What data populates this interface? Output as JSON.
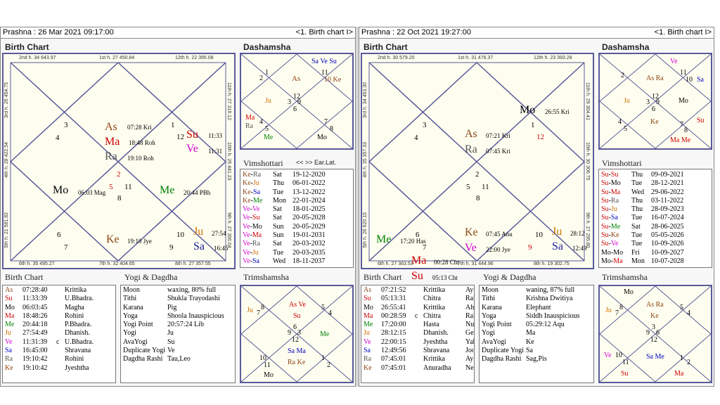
{
  "left": {
    "title": "Prashna :  26 Mar 2021  09:17:00",
    "nav": "<1. Birth chart I>",
    "birth_chart_label": "Birth Chart",
    "dashamsha_label": "Dashamsha",
    "vimshottari_label": "Vimshottari",
    "vim_nav": "<< >> Ear.Lat.",
    "trimshamsha_label": "Trimshamsha",
    "yogi_label": "Yogi & Dagdha",
    "edges": {
      "top1": "2nd h.  34  643.97",
      "top2": "1st h.  27  450.84",
      "top3": "12th h.  22  395.08",
      "bot1": "6th h.  35  495.27",
      "bot2": "7th h.  32  404.65",
      "bot3": "8th h.  27  357.55",
      "l1": "3rd h.  26  454.75",
      "l2": "4th h.  28  422.54",
      "l3": "5th h.  21  581.82",
      "r1": "11th h.  27  316.12",
      "r2": "10th h.  26  441.23",
      "r3": "9th h.  27  356.04"
    },
    "chart_texts": [
      "3",
      "4",
      "As",
      "07:28 Kri",
      "Ma",
      "18:48 Roh",
      "Ra",
      "19:10 Roh",
      "2",
      "5",
      "1",
      "12",
      "Su",
      "11:33",
      "Ve",
      "11:31",
      "Mo",
      "06:03 Mag",
      "11",
      "8",
      "Me",
      "20:44 PBh",
      "6",
      "7",
      "Ke",
      "19:10 Jye",
      "10",
      "9",
      "Ju",
      "27:54",
      "Sa",
      "16:45"
    ],
    "d10": [
      "2",
      "1",
      "As",
      "11",
      "10 Ke",
      "Ju",
      "12",
      "3",
      "9",
      "6",
      "Ma",
      "Ra",
      "4",
      "5",
      "7",
      "8",
      "Me",
      "Mo",
      "Sa Ve Su"
    ],
    "vimshottari": [
      [
        "Ke-Ra",
        "Sat",
        "19-12-2020"
      ],
      [
        "Ke-Ju",
        "Thu",
        "06-01-2022"
      ],
      [
        "Ke-Sa",
        "Tue",
        "13-12-2022"
      ],
      [
        "Ke-Me",
        "Mon",
        "22-01-2024"
      ],
      [
        "Ve-Ve",
        "Sat",
        "18-01-2025"
      ],
      [
        "Ve-Su",
        "Sat",
        "20-05-2028"
      ],
      [
        "Ve-Mo",
        "Sun",
        "20-05-2029"
      ],
      [
        "Ve-Ma",
        "Sun",
        "19-01-2031"
      ],
      [
        "Ve-Ra",
        "Sat",
        "20-03-2032"
      ],
      [
        "Ve-Ju",
        "Tue",
        "20-03-2035"
      ],
      [
        "Ve-Sa",
        "Wed",
        "18-11-2037"
      ]
    ],
    "planets": [
      [
        "As",
        "07:28:40",
        "",
        "Krittika"
      ],
      [
        "Su",
        "11:33:39",
        "",
        "U.Bhadra."
      ],
      [
        "Mo",
        "06:03:45",
        "",
        "Magha"
      ],
      [
        "Ma",
        "18:48:26",
        "",
        "Rohini"
      ],
      [
        "Me",
        "20:44:18",
        "",
        "P.Bhadra."
      ],
      [
        "Ju",
        "27:54:49",
        "",
        "Dhanish."
      ],
      [
        "Ve",
        "11:31:39",
        "c",
        "U.Bhadra."
      ],
      [
        "Sa",
        "16:45:00",
        "",
        "Shravana"
      ],
      [
        "Ra",
        "19:10:42",
        "",
        "Rohini"
      ],
      [
        "Ke",
        "19:10:42",
        "",
        "Jyeshtha"
      ]
    ],
    "yogi": [
      [
        "Moon",
        "waxing, 80% full"
      ],
      [
        "Tithi",
        "Shukla  Trayodashi"
      ],
      [
        "Karana",
        "Pig"
      ],
      [
        "Yoga",
        "Shoola Inauspicious"
      ],
      [
        "Yogi Point",
        "20:57:24 Lib"
      ],
      [
        "Yogi",
        "Ju"
      ],
      [
        "AvaYogi",
        "Su"
      ],
      [
        "Duplicate Yogi",
        "Ve"
      ],
      [
        "Dagdha Rashi",
        "Tau,Leo"
      ]
    ],
    "d30": [
      "As Ve",
      "Su",
      "8",
      "7",
      "5",
      "4",
      "Ju",
      "9",
      "3",
      "6",
      "12",
      "Me",
      "Sa Ma",
      "Ra Ke",
      "10",
      "11",
      "1",
      "2",
      "Mo"
    ]
  },
  "right": {
    "title": "Prashna :  22 Oct 2021  19:27:00",
    "nav": "<1. Birth chart I>",
    "birth_chart_label": "Birth Chart",
    "dashamsha_label": "Dashamsha",
    "vimshottari_label": "Vimshottari",
    "vim_nav": "<< >> Ear.Lat.",
    "trimshamsha_label": "Trimshamsha",
    "yogi_label": "Yogi & Dagdha",
    "edges": {
      "top1": "2nd h.  30  579.20",
      "top2": "1st h.  31  476.37",
      "top3": "12th h.  23  393.28",
      "bot1": "6th h.  27  363.53",
      "bot2": "7th h.  31  444.96",
      "bot3": "8th h.  19  302.75",
      "l1": "3rd h.  34  453.30",
      "l2": "4th h.  35  357.33",
      "l3": "5th h.  26  620.15",
      "r1": "11th h.  29  304.41",
      "r2": "10th h.  30  306.75",
      "r3": "9th h.  27  295.80"
    },
    "chart_texts": [
      "Mo",
      "26:55 Kri",
      "1",
      "12",
      "3",
      "4",
      "As",
      "07:21 Kri",
      "Ra",
      "07:45 Kri",
      "2",
      "5",
      "11",
      "8",
      "Me",
      "17:20 Has",
      "6",
      "7",
      "Ke",
      "07:45 Anu",
      "Ve",
      "22:00 Jye",
      "10",
      "9",
      "Ju",
      "28:12",
      "Sa",
      "12:49",
      "Ma",
      "00:28 Cht",
      "Su",
      "05:13 Cht"
    ],
    "d10": [
      "Ve",
      "2",
      "As Ra",
      "11",
      "10",
      "Sa",
      "Ju",
      "12",
      "3",
      "6",
      "9",
      "Mo",
      "Ke",
      "4",
      "5",
      "7",
      "8",
      "Su",
      "Ma Me"
    ],
    "vimshottari": [
      [
        "Su-Su",
        "Thu",
        "09-09-2021"
      ],
      [
        "Su-Mo",
        "Tue",
        "28-12-2021"
      ],
      [
        "Su-Ma",
        "Wed",
        "29-06-2022"
      ],
      [
        "Su-Ra",
        "Thu",
        "03-11-2022"
      ],
      [
        "Su-Ju",
        "Thu",
        "28-09-2023"
      ],
      [
        "Su-Sa",
        "Tue",
        "16-07-2024"
      ],
      [
        "Su-Me",
        "Sat",
        "28-06-2025"
      ],
      [
        "Su-Ke",
        "Tue",
        "05-05-2026"
      ],
      [
        "Su-Ve",
        "Tue",
        "10-09-2026"
      ],
      [
        "Mo-Mo",
        "Fri",
        "10-09-2027"
      ],
      [
        "Mo-Ma",
        "Mon",
        "10-07-2028"
      ]
    ],
    "planets": [
      [
        "As",
        "07:21:52",
        "",
        "Krittika",
        "Ay"
      ],
      [
        "Su",
        "05:13:31",
        "",
        "Chitra",
        "Rah"
      ],
      [
        "Mo",
        "26:55:41",
        "",
        "Krittika",
        "Ah"
      ],
      [
        "Ma",
        "00:28:59",
        "c",
        "Chitra",
        "Rah"
      ],
      [
        "Me",
        "17:20:00",
        "",
        "Hasta",
        "Nuh"
      ],
      [
        "Ju",
        "28:12:15",
        "",
        "Dhanish.",
        "Gee"
      ],
      [
        "Ve",
        "22:00:15",
        "",
        "Jyeshtha",
        "Yah"
      ],
      [
        "Sa",
        "12:49:56",
        "",
        "Shravana",
        "Joo"
      ],
      [
        "Ra",
        "07:45:01",
        "",
        "Krittika",
        "Ay"
      ],
      [
        "Ke",
        "07:45:01",
        "",
        "Anuradha",
        "Nee"
      ]
    ],
    "yogi": [
      [
        "Moon",
        "waning, 87% full"
      ],
      [
        "Tithi",
        "Krishna  Dwitiya"
      ],
      [
        "Karana",
        "Elephant"
      ],
      [
        "Yoga",
        "Siddh Inauspicious"
      ],
      [
        "Yogi Point",
        "05:29:12 Aqu"
      ],
      [
        "Yogi",
        "Ma"
      ],
      [
        "AvaYogi",
        "Ke"
      ],
      [
        "Duplicate Yogi",
        "Sa"
      ],
      [
        "Dagdha Rashi",
        "Sag,Pis"
      ]
    ],
    "d30": [
      "Mo",
      "As Ra",
      "Ke",
      "Ju",
      "8",
      "7",
      "5",
      "4",
      "9",
      "3",
      "6",
      "12",
      "Ve",
      "10",
      "11",
      "Sa Me",
      "1",
      "2",
      "Su",
      "Ma"
    ]
  }
}
